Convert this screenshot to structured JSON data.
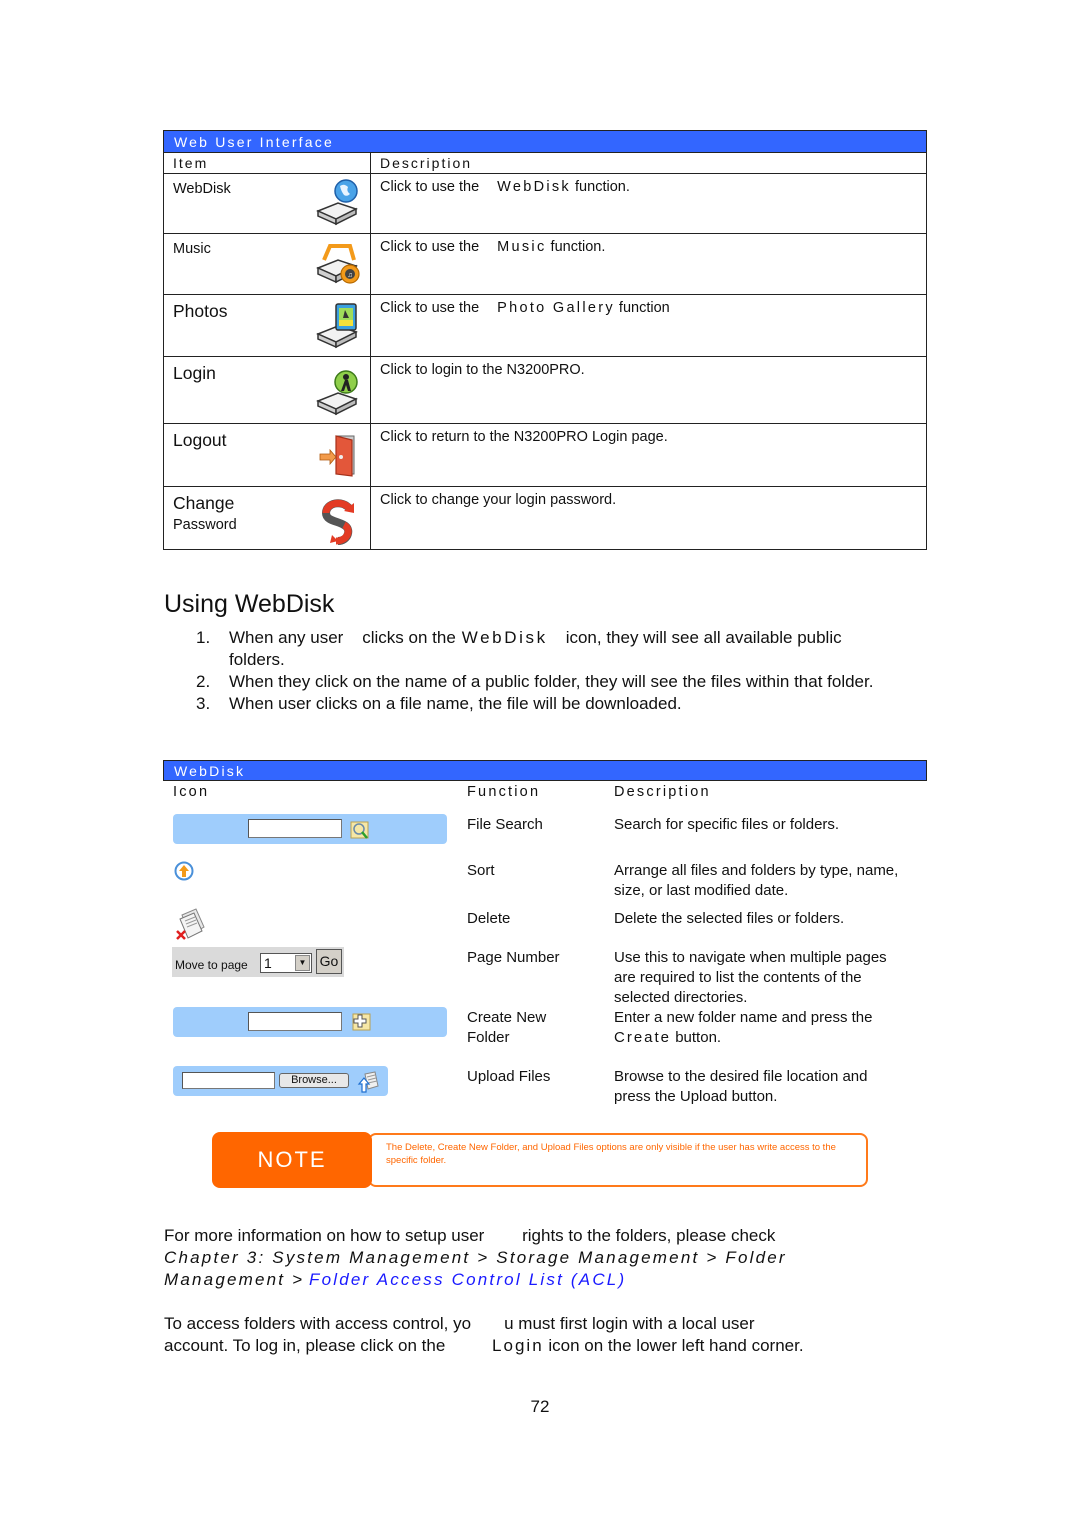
{
  "ui_table": {
    "title": "Web User Interface",
    "col_item": "Item",
    "col_description": "Description",
    "rows": [
      {
        "item": "WebDisk",
        "desc_prefix": "Click to use the",
        "desc_keyword": "WebDisk",
        "desc_suffix": "function.",
        "icon": "webdisk-globe-drive-icon"
      },
      {
        "item": "Music",
        "desc_prefix": "Click to use the",
        "desc_keyword": "Music",
        "desc_suffix": "function.",
        "icon": "music-drive-icon"
      },
      {
        "item": "Photos",
        "desc_prefix": "Click to use the",
        "desc_keyword": "Photo Gallery",
        "desc_suffix": "function",
        "icon": "photo-drive-icon"
      },
      {
        "item": "Login",
        "desc": "Click to login to the N3200PRO.",
        "icon": "login-drive-icon"
      },
      {
        "item": "Logout",
        "desc": "Click to return to the N3200PRO Login page.",
        "icon": "logout-door-icon"
      },
      {
        "item": "Change",
        "item_sub": "Password",
        "desc": "Click to change your login password.",
        "icon": "change-password-icon"
      }
    ]
  },
  "section": {
    "title": "Using WebDisk",
    "steps": [
      {
        "num": "1.",
        "pre": "When any user    clicks on the",
        "kw": "WebDisk",
        "post": "icon, they will see all available public folders."
      },
      {
        "num": "2.",
        "text": "When they click on the name of a public folder, they will see the files within that folder."
      },
      {
        "num": "3.",
        "text": "When user clicks on a file name, the file will be downloaded."
      }
    ]
  },
  "webdisk_table": {
    "title": "WebDisk",
    "col_icon": "Icon",
    "col_function": "Function",
    "col_description": "Description",
    "rows": [
      {
        "function": "File Search",
        "description": "Search for specific files or folders."
      },
      {
        "function": "Sort",
        "description": "Arrange all files and folders by type, name, size, or last modified date."
      },
      {
        "function": "Delete",
        "description": "Delete the selected files or folders."
      },
      {
        "function": "Page Number",
        "description": "Use this to navigate when multiple pages are required to list the contents of the selected directories."
      },
      {
        "function": "Create New Folder",
        "description_pre": "Enter a new folder name and press the",
        "description_kw": "Create",
        "description_post": "button."
      },
      {
        "function": "Upload Files",
        "description": "Browse to the desired file location and press the Upload button."
      }
    ],
    "pager": {
      "label": "Move to page",
      "selected": "1",
      "go": "Go"
    },
    "browse_label": "Browse..."
  },
  "note": {
    "tag": "NOTE",
    "text": "The Delete, Create New Folder, and Upload Files options are only visible if the user has write access to the specific folder."
  },
  "more_info": {
    "pre": "For more information on how to setup user        rights to the folders, please check",
    "path": "Chapter 3: System Management > Storage Management > Folder Management >",
    "link": "Folder Access Control List (ACL)"
  },
  "access": {
    "line1": "To access folders with access control, yo       u must first login with a local user",
    "line2_pre": "account. To log in, please click on the",
    "line2_kw": "Login",
    "line2_post": "icon on the lower left hand corner."
  },
  "page_number": "72",
  "colors": {
    "header_blue": "#3366ff",
    "note_orange": "#ff6600",
    "link_blue": "#1a1aff",
    "toolbar_blue": "#9fcdfc"
  }
}
